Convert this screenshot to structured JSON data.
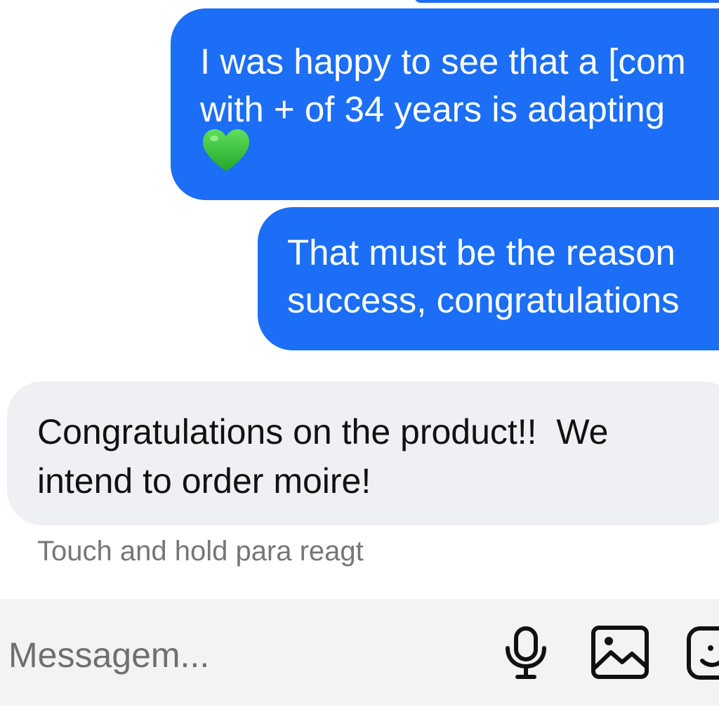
{
  "conversation": {
    "sent_messages": [
      {
        "lines": [
          "I was happy to see that a [com",
          "with + of 34 years is adapting"
        ],
        "emoji": "green-heart"
      },
      {
        "lines": [
          "That must be the reason",
          "success, congratulations"
        ]
      }
    ],
    "received_message": {
      "lines": [
        "Congratulations on the product!!  We",
        "intend to order moire!"
      ]
    },
    "reaction_hint": "Touch and hold para reagt"
  },
  "composer": {
    "placeholder": "Messagem...",
    "value": "",
    "icons": [
      "microphone-icon",
      "image-icon",
      "sticker-icon"
    ]
  },
  "colors": {
    "sent_bubble": "#1b6ef5",
    "received_bubble": "#eef0f3",
    "heart": "#2fbe3a",
    "composer_bg": "#f3f3f3"
  }
}
